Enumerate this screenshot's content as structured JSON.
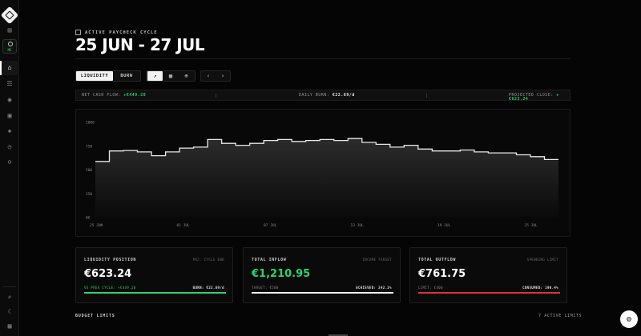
{
  "header": {
    "crumb": "ACTIVE PAYCHECK CYCLE",
    "title": "25 JUN - 27 JUL"
  },
  "user": {
    "tag": "ME"
  },
  "toolbar": {
    "tabs": [
      {
        "label": "LIQUIDITY",
        "active": true
      },
      {
        "label": "BURN",
        "active": false
      }
    ],
    "tools": [
      "trend-icon",
      "calendar-icon",
      "globe-icon"
    ],
    "prev": "‹",
    "next": "›"
  },
  "stats": {
    "net_label": "NET CASH FLOW:",
    "net_value": "+€449.20",
    "burn_label": "DAILY BURN:",
    "burn_value": "€22.69/d",
    "proj_label": "PROJECTED CLOSE:",
    "proj_value": "+€623.24"
  },
  "chart_data": {
    "type": "area",
    "step": true,
    "ylim": [
      0,
      1000
    ],
    "yticks": [
      "1000",
      "750",
      "500",
      "250",
      "0€"
    ],
    "xticks": [
      "25 JUN",
      "01 JUL",
      "07 JUL",
      "13 JUL",
      "19 JUL",
      "25 JUL"
    ],
    "values": [
      590,
      700,
      705,
      690,
      650,
      690,
      730,
      740,
      820,
      780,
      760,
      780,
      810,
      820,
      800,
      810,
      820,
      810,
      830,
      790,
      770,
      740,
      760,
      720,
      700,
      700,
      710,
      690,
      680,
      680,
      660,
      640,
      610
    ],
    "colors": {
      "line": "#e8e8e8",
      "fill_top": "#2c2c2c",
      "fill_bottom": "#0a0a0a"
    }
  },
  "cards": [
    {
      "title": "LIQUIDITY POSITION",
      "tag": "PRJ. CYCLE END",
      "value": "€623.24",
      "value_green": false,
      "foot_left": "VS PREV CYCLE: +€449.20",
      "foot_left_green": true,
      "foot_right": "BURN: €22.69/d",
      "progress": 1.0,
      "bar_color": "#2bd46f"
    },
    {
      "title": "TOTAL INFLOW",
      "tag": "INCOME TARGET",
      "value": "€1,210.95",
      "value_green": true,
      "foot_left": "TARGET: €500",
      "foot_left_green": false,
      "foot_right": "ACHIEVED: 242.2%",
      "progress": 1.0,
      "bar_color": "#f0f0f0"
    },
    {
      "title": "TOTAL OUTFLOW",
      "tag": "SPENDING LIMIT",
      "value": "€761.75",
      "value_green": false,
      "foot_left": "LIMIT: €400",
      "foot_left_green": false,
      "foot_right": "CONSUMED: 190.4%",
      "progress": 1.0,
      "bar_color": "#e5303a"
    }
  ],
  "footer": {
    "left": "BUDGET LIMITS",
    "right": "7 ACTIVE LIMITS"
  }
}
